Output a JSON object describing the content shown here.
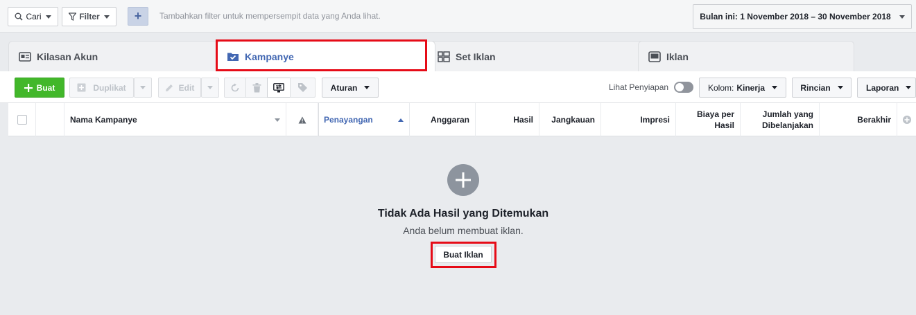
{
  "topbar": {
    "search_label": "Cari",
    "filter_label": "Filter",
    "add_filter_icon": "plus-icon",
    "hint": "Tambahkan filter untuk mempersempit data yang Anda lihat.",
    "date_range": "Bulan ini: 1 November 2018 – 30 November 2018"
  },
  "tabs": [
    {
      "label": "Kilasan Akun",
      "icon": "account-overview-icon"
    },
    {
      "label": "Kampanye",
      "icon": "campaign-folder-icon",
      "active": true
    },
    {
      "label": "Set Iklan",
      "icon": "ad-set-grid-icon"
    },
    {
      "label": "Iklan",
      "icon": "ad-monitor-icon"
    }
  ],
  "toolbar": {
    "create_label": "Buat",
    "duplicate_label": "Duplikat",
    "edit_label": "Edit",
    "rules_label": "Aturan",
    "preview_label": "Lihat Penyiapan",
    "columns_prefix": "Kolom:",
    "columns_value": "Kinerja",
    "breakdown_label": "Rincian",
    "reports_label": "Laporan"
  },
  "table": {
    "columns": {
      "name": "Nama Kampanye",
      "delivery": "Penayangan",
      "budget": "Anggaran",
      "results": "Hasil",
      "reach": "Jangkauan",
      "impressions": "Impresi",
      "cost_per_result_1": "Biaya per",
      "cost_per_result_2": "Hasil",
      "amount_spent_1": "Jumlah yang",
      "amount_spent_2": "Dibelanjakan",
      "ends": "Berakhir"
    }
  },
  "empty_state": {
    "title": "Tidak Ada Hasil yang Ditemukan",
    "subtitle": "Anda belum membuat iklan.",
    "button_label": "Buat Iklan"
  },
  "colors": {
    "accent_blue": "#4267b2",
    "create_green": "#42b72a",
    "highlight_red": "#e60b17",
    "background": "#e9ebee"
  }
}
